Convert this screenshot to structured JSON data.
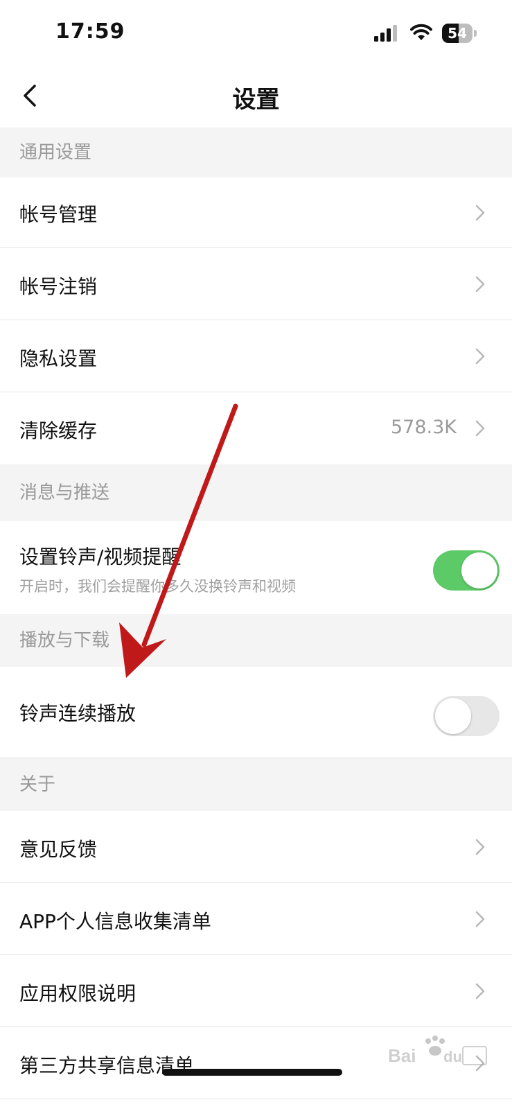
{
  "status_bar": {
    "time": "17:59",
    "battery": "54",
    "battery_level": 0.54
  },
  "nav": {
    "title": "设置",
    "back_icon": "chevron-left-icon"
  },
  "sections": {
    "general": "通用设置",
    "messages": "消息与推送",
    "playback": "播放与下载",
    "about": "关于"
  },
  "rows": {
    "account_manage": "帐号管理",
    "account_cancel": "帐号注销",
    "privacy": "隐私设置",
    "clear_cache": "清除缓存",
    "cache_size": "578.3K",
    "ringtone_reminder": "设置铃声/视频提醒",
    "ringtone_reminder_sub": "开启时，我们会提醒你多久没换铃声和视频",
    "ringtone_reminder_on": true,
    "continuous_play": "铃声连续播放",
    "continuous_play_on": false,
    "feedback": "意见反馈",
    "info_list": "APP个人信息收集清单",
    "permissions": "应用权限说明",
    "third_party": "第三方共享信息清单"
  },
  "colors": {
    "toggle_on": "#5dca68",
    "arrow": "#c0191a",
    "section_bg": "#f4f4f4"
  }
}
